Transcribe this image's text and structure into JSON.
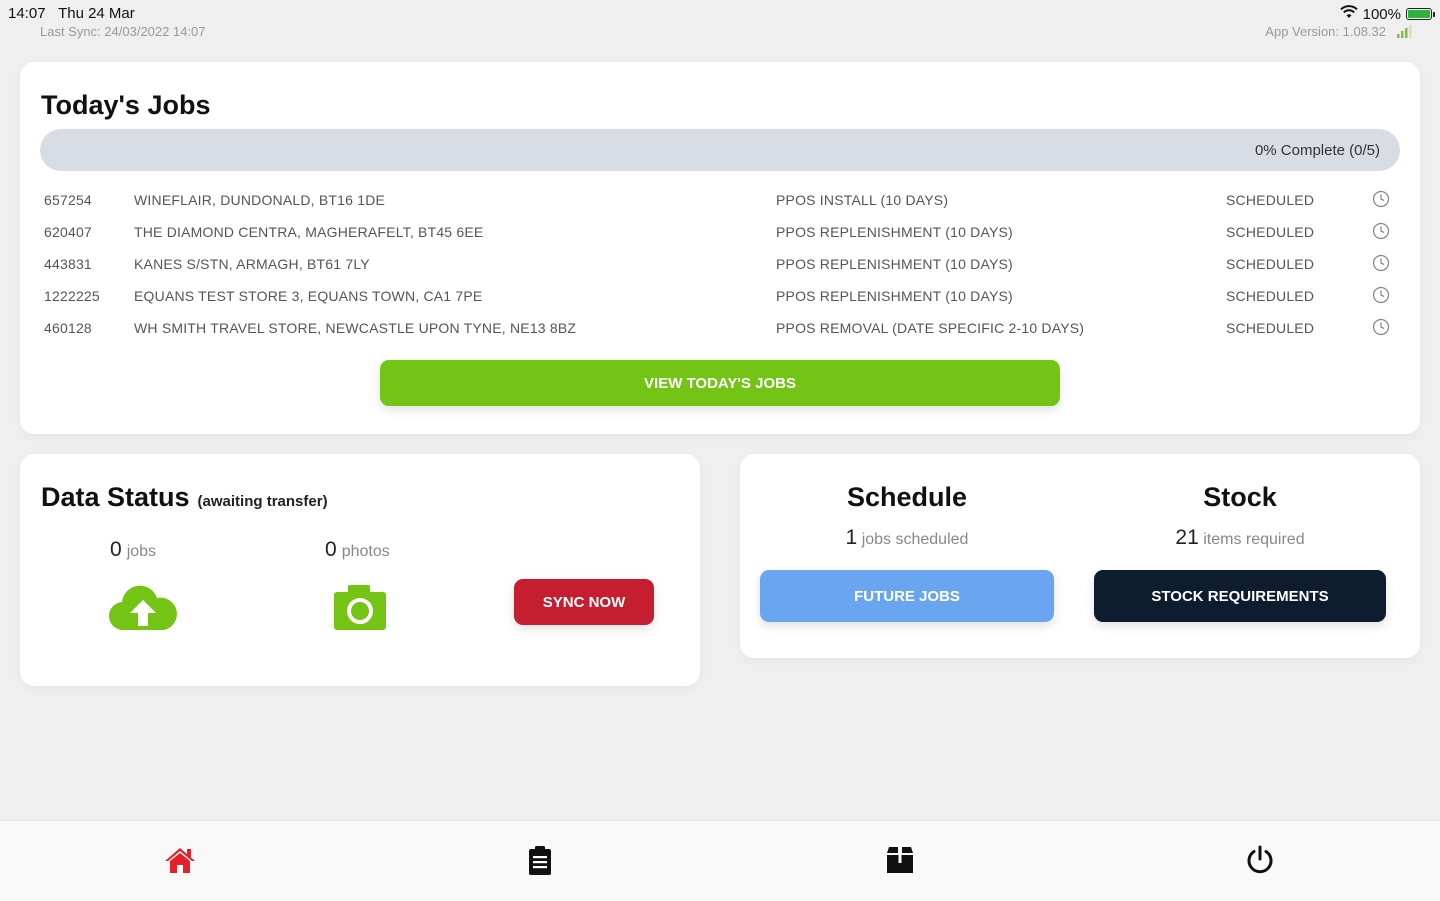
{
  "status_bar": {
    "time": "14:07",
    "date": "Thu 24 Mar",
    "last_sync": "Last Sync: 24/03/2022 14:07",
    "battery": "100%",
    "app_version": "App Version: 1.08.32"
  },
  "jobs_card": {
    "title": "Today's Jobs",
    "progress_label": "0% Complete (0/5)",
    "progress_fraction": 0,
    "rows": [
      {
        "id": "657254",
        "address": "WINEFLAIR, DUNDONALD, BT16 1DE",
        "type": "PPOS INSTALL (10 DAYS)",
        "status": "SCHEDULED"
      },
      {
        "id": "620407",
        "address": "THE DIAMOND CENTRA, MAGHERAFELT, BT45 6EE",
        "type": "PPOS REPLENISHMENT (10 DAYS)",
        "status": "SCHEDULED"
      },
      {
        "id": "443831",
        "address": "KANES S/STN, ARMAGH, BT61 7LY",
        "type": "PPOS REPLENISHMENT (10 DAYS)",
        "status": "SCHEDULED"
      },
      {
        "id": "1222225",
        "address": "EQUANS TEST STORE 3, EQUANS TOWN, CA1 7PE",
        "type": "PPOS REPLENISHMENT (10 DAYS)",
        "status": "SCHEDULED"
      },
      {
        "id": "460128",
        "address": "WH SMITH TRAVEL STORE, NEWCASTLE UPON TYNE, NE13 8BZ",
        "type": "PPOS REMOVAL (DATE SPECIFIC 2-10 DAYS)",
        "status": "SCHEDULED"
      }
    ],
    "view_button": "VIEW TODAY'S JOBS"
  },
  "data_status": {
    "title": "Data Status",
    "subtitle": "(awaiting transfer)",
    "jobs_count": "0",
    "jobs_unit": "jobs",
    "photos_count": "0",
    "photos_unit": "photos",
    "sync_button": "SYNC NOW"
  },
  "schedule": {
    "title": "Schedule",
    "count": "1",
    "unit": "jobs scheduled",
    "button": "FUTURE JOBS"
  },
  "stock": {
    "title": "Stock",
    "count": "21",
    "unit": "items required",
    "button": "STOCK REQUIREMENTS"
  },
  "colors": {
    "green": "#74c415",
    "red": "#c41e30",
    "blue": "#6aa6f0",
    "navy": "#0d1c2e",
    "home_active": "#e4202b"
  },
  "tabs": [
    {
      "name": "home",
      "icon": "home-icon",
      "active": true
    },
    {
      "name": "jobs",
      "icon": "clipboard-icon",
      "active": false
    },
    {
      "name": "stock",
      "icon": "box-icon",
      "active": false
    },
    {
      "name": "logout",
      "icon": "power-icon",
      "active": false
    }
  ]
}
